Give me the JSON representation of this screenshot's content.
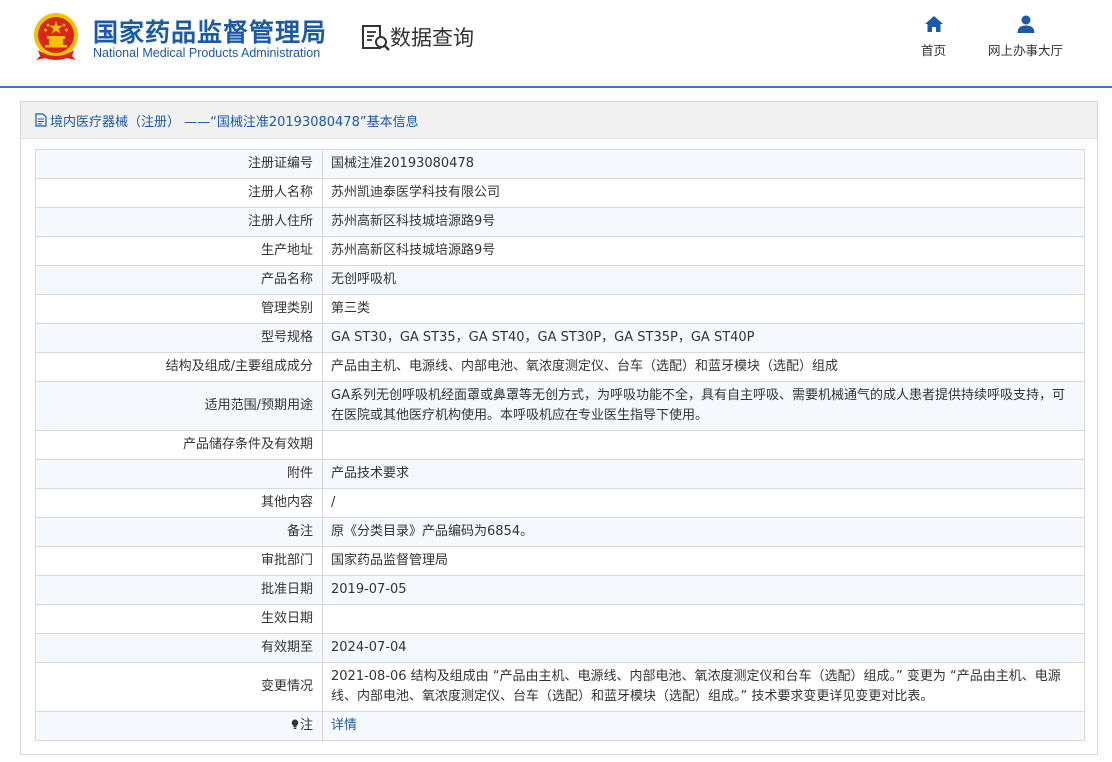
{
  "header": {
    "agency_cn": "国家药品监督管理局",
    "agency_en": "National Medical Products Administration",
    "query_title": "数据查询",
    "nav": [
      {
        "label": "首页",
        "icon": "home-icon"
      },
      {
        "label": "网上办事大厅",
        "icon": "user-icon"
      }
    ]
  },
  "panel": {
    "title": "境内医疗器械（注册） ——“国械注准20193080478”基本信息",
    "rows": [
      {
        "key": "注册证编号",
        "value": "国械注准20193080478"
      },
      {
        "key": "注册人名称",
        "value": "苏州凯迪泰医学科技有限公司"
      },
      {
        "key": "注册人住所",
        "value": "苏州高新区科技城培源路9号"
      },
      {
        "key": "生产地址",
        "value": "苏州高新区科技城培源路9号"
      },
      {
        "key": "产品名称",
        "value": "无创呼吸机"
      },
      {
        "key": "管理类别",
        "value": "第三类"
      },
      {
        "key": "型号规格",
        "value": "GA ST30，GA ST35，GA ST40，GA ST30P，GA ST35P，GA ST40P"
      },
      {
        "key": "结构及组成/主要组成成分",
        "value": "产品由主机、电源线、内部电池、氧浓度测定仪、台车（选配）和蓝牙模块（选配）组成"
      },
      {
        "key": "适用范围/预期用途",
        "value": "GA系列无创呼吸机经面罩或鼻罩等无创方式，为呼吸功能不全，具有自主呼吸、需要机械通气的成人患者提供持续呼吸支持，可在医院或其他医疗机构使用。本呼吸机应在专业医生指导下使用。"
      },
      {
        "key": "产品储存条件及有效期",
        "value": ""
      },
      {
        "key": "附件",
        "value": "产品技术要求"
      },
      {
        "key": "其他内容",
        "value": "/"
      },
      {
        "key": "备注",
        "value": "原《分类目录》产品编码为6854。"
      },
      {
        "key": "审批部门",
        "value": "国家药品监督管理局"
      },
      {
        "key": "批准日期",
        "value": "2019-07-05"
      },
      {
        "key": "生效日期",
        "value": ""
      },
      {
        "key": "有效期至",
        "value": "2024-07-04"
      },
      {
        "key": "变更情况",
        "value": "2021-08-06 结构及组成由 “产品由主机、电源线、内部电池、氧浓度测定仪和台车（选配）组成。” 变更为 “产品由主机、电源线、内部电池、氧浓度测定仪、台车（选配）和蓝牙模块（选配）组成。” 技术要求变更详见变更对比表。"
      }
    ],
    "note": {
      "key": "注",
      "link": "详情"
    }
  },
  "colors": {
    "brand": "#1a5aa6",
    "header_rule": "#3a7bbf",
    "emblem_red": "#d9261c",
    "emblem_gold": "#f2c200",
    "row_alt": "#f5f8fc"
  }
}
